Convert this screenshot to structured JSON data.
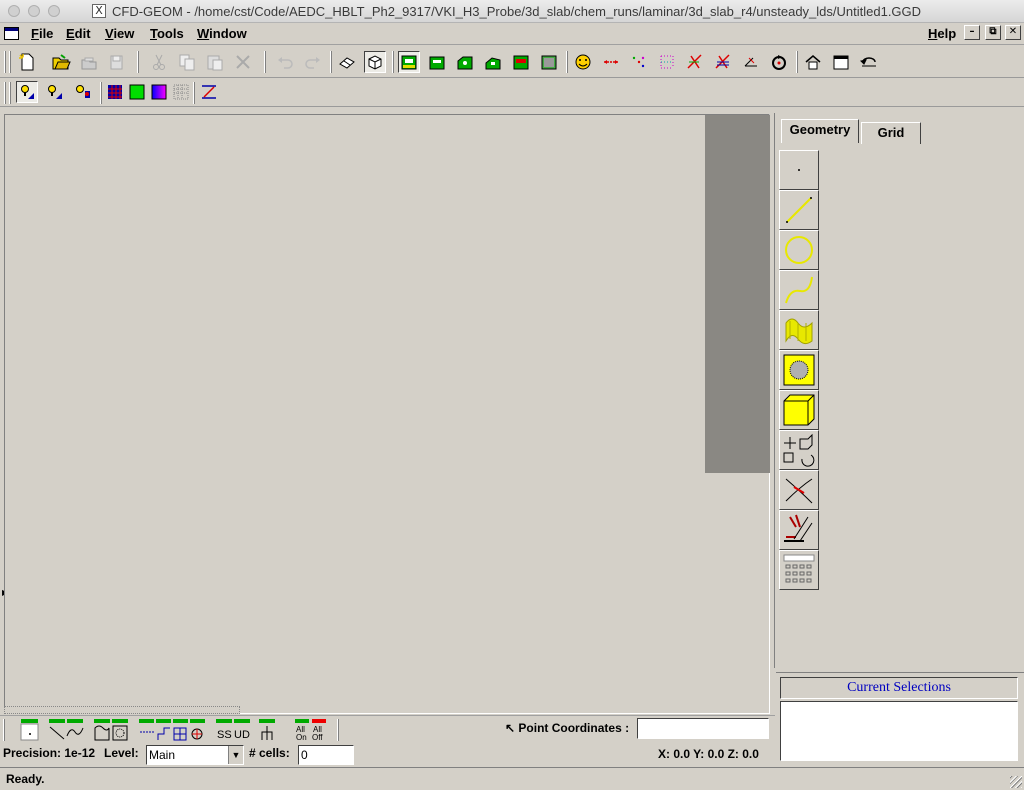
{
  "window": {
    "title": "CFD-GEOM - /home/cst/Code/AEDC_HBLT_Ph2_9317/VKI_H3_Probe/3d_slab/chem_runs/laminar/3d_slab_r4/unsteady_lds/Untitled1.GGD",
    "x_glyph": "X"
  },
  "menu": {
    "file": "File",
    "edit": "Edit",
    "view": "View",
    "tools": "Tools",
    "window": "Window",
    "help": "Help",
    "minimize": "–",
    "restore": "⧉",
    "close": "✕"
  },
  "toolbar1": {
    "icons": [
      "new-file-icon",
      "open-folder-icon",
      "save-icon",
      "save-as-icon",
      "cut-icon",
      "copy-icon",
      "paste-icon",
      "delete-icon",
      "undo-icon",
      "redo-icon",
      "shaded-view-icon",
      "wireframe-view-icon",
      "block-view-1-icon",
      "block-view-2-icon",
      "block-view-3-icon",
      "block-view-4-icon",
      "block-view-5-icon",
      "block-view-6-icon",
      "smiley-tool-icon",
      "dimension-icon",
      "points-icon",
      "grid-points-icon",
      "split-icon",
      "split-multi-icon",
      "angle-icon",
      "rotate-icon",
      "home-view-icon",
      "maximize-view-icon",
      "redraw-icon"
    ]
  },
  "toolbar2": {
    "icons": [
      "light-1-icon",
      "light-2-icon",
      "light-3-icon",
      "mesh-color-icon",
      "green-fill-icon",
      "blue-gradient-icon",
      "dotted-grid-icon",
      "axis-icon"
    ]
  },
  "tabs": {
    "geometry": "Geometry",
    "grid": "Grid"
  },
  "geometry_tools": [
    "point-tool-icon",
    "line-tool-icon",
    "circle-tool-icon",
    "curve-tool-icon",
    "surface-tool-icon",
    "face-tool-icon",
    "block-tool-icon",
    "transform-tool-icon",
    "intersect-tool-icon",
    "trim-tool-icon",
    "calculator-tool-icon"
  ],
  "bottom": {
    "point_coordinates_label": "Point Coordinates :",
    "point_coordinates_value": "",
    "pointer_glyph": "↖",
    "ss_label": "SS",
    "ud_label": "UD",
    "all_on": "All On",
    "all_off": "All Off"
  },
  "status_row": {
    "precision": "Precision: 1e-12",
    "level_label": "Level:",
    "level_value": "Main",
    "cells_label": "# cells:",
    "cells_value": "0",
    "coords": "X: 0.0 Y: 0.0 Z: 0.0"
  },
  "selections": {
    "title": "Current Selections"
  },
  "status": {
    "text": "Ready."
  },
  "colors": {
    "accent_yellow": "#ffff00",
    "selection_title": "#0000c0",
    "viewport_bg": "#d4d0c8",
    "panel_gray": "#8a8883"
  }
}
